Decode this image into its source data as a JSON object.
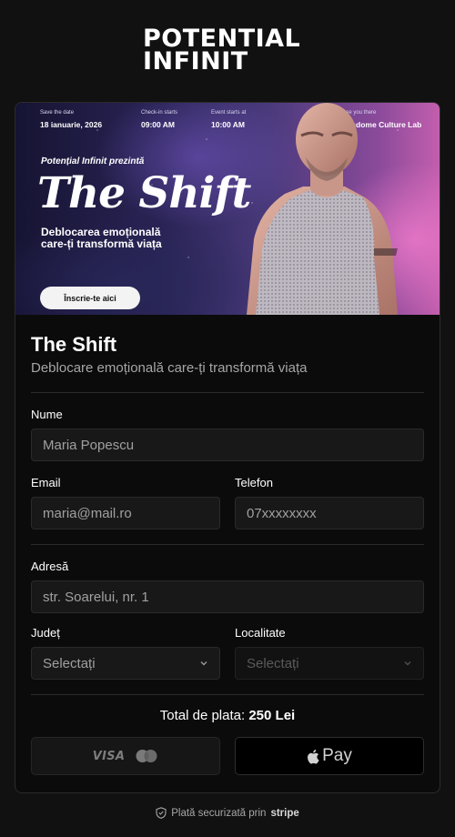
{
  "brand": {
    "line1": "POTENTIAL",
    "line2": "INFINIT"
  },
  "banner": {
    "info": [
      {
        "label": "Save the date",
        "value": "18 ianuarie, 2026"
      },
      {
        "label": "Check-in starts",
        "value": "09:00 AM"
      },
      {
        "label": "Event starts at",
        "value": "10:00 AM"
      },
      {
        "label": "See you there",
        "value": "Wisdome Culture Lab"
      }
    ],
    "presents": "Potențial Infinit prezintă",
    "title": "The Shift",
    "tagline": "Deblocarea emoțională care-ți transformă viața",
    "cta": "Înscrie-te aici"
  },
  "form": {
    "title": "The Shift",
    "subtitle": "Deblocare emoțională care-ți transformă viața",
    "name": {
      "label": "Nume",
      "value": "Maria Popescu"
    },
    "email": {
      "label": "Email",
      "value": "maria@mail.ro"
    },
    "phone": {
      "label": "Telefon",
      "value": "07xxxxxxxx"
    },
    "address": {
      "label": "Adresă",
      "value": "str. Soarelui, nr. 1"
    },
    "county": {
      "label": "Județ",
      "value": "Selectați"
    },
    "locality": {
      "label": "Localitate",
      "value": "Selectați"
    },
    "total_label": "Total de plata:",
    "total_value": "250 Lei",
    "card_brand": "VISA",
    "apple_pay": "Pay"
  },
  "footer": {
    "secure_text": "Plată securizată prin",
    "provider": "stripe"
  },
  "colors": {
    "background": "#111111",
    "card": "#0b0b0b",
    "input": "#181818",
    "accent_pink": "#c45fae"
  }
}
